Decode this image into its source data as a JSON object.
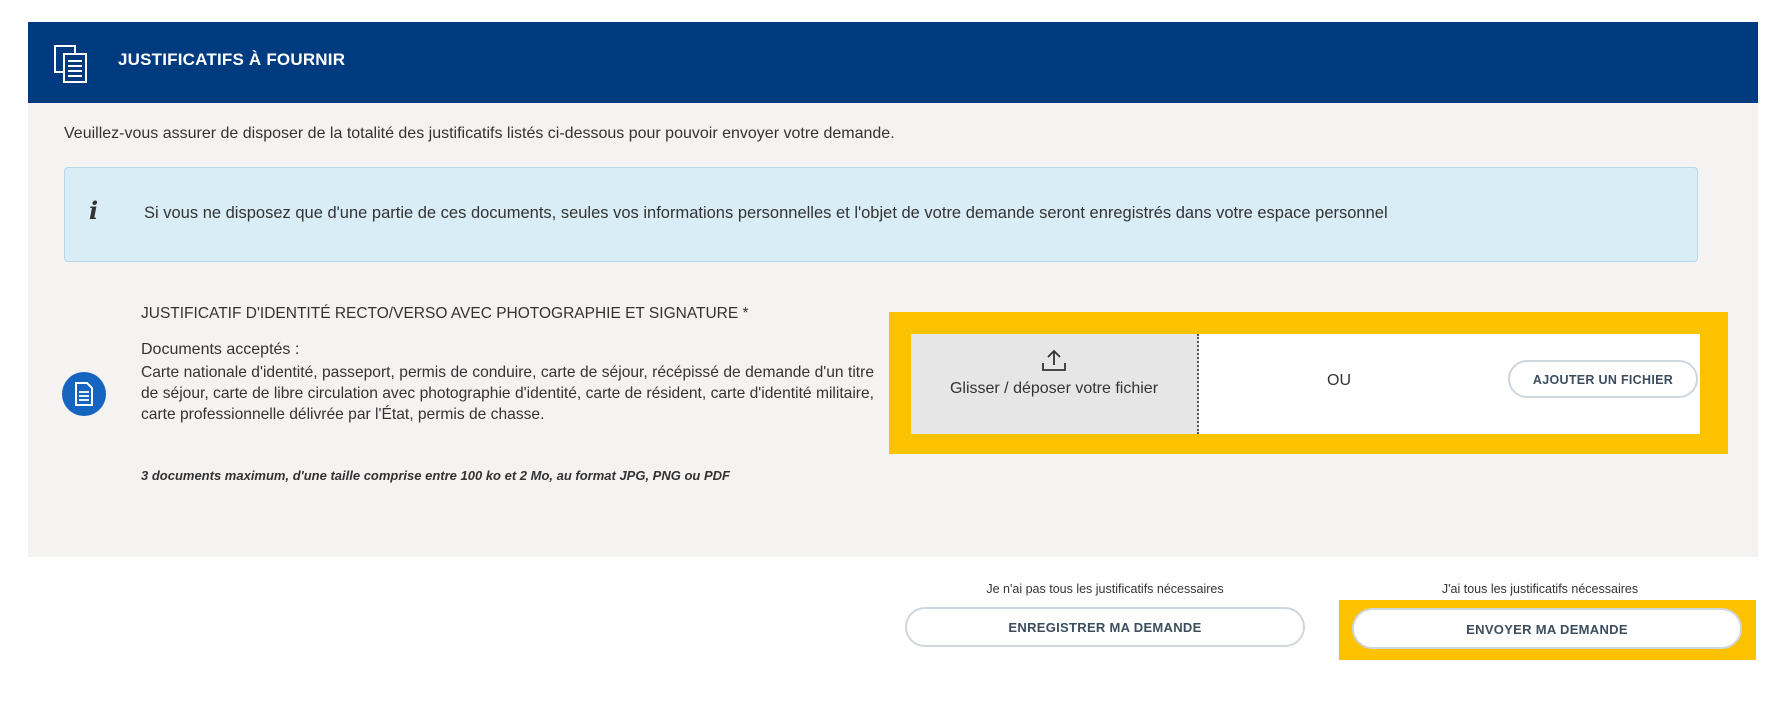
{
  "header": {
    "title": "JUSTIFICATIFS À FOURNIR",
    "icon": "documents-icon"
  },
  "intro": "Veuillez-vous assurer de disposer de la totalité des justificatifs listés ci-dessous pour pouvoir envoyer votre demande.",
  "info": {
    "icon_glyph": "i",
    "text": "Si vous ne disposez que d'une partie de ces documents, seules vos informations personnelles et l'objet de votre demande seront enregistrés dans votre espace personnel"
  },
  "document": {
    "title": "JUSTIFICATIF D'IDENTITÉ RECTO/VERSO AVEC PHOTOGRAPHIE ET SIGNATURE *",
    "accepted_label": "Documents acceptés :",
    "accepted_list": "Carte nationale d'identité, passeport, permis de conduire, carte de séjour, récépissé de demande d'un titre de séjour, carte de libre circulation avec photographie d'identité, carte de résident, carte d'identité militaire, carte professionnelle délivrée par l'État, permis de chasse.",
    "constraints": "3 documents maximum, d'une taille comprise entre 100 ko et 2 Mo, au format JPG, PNG ou PDF"
  },
  "upload": {
    "dropzone_label": "Glisser / déposer votre fichier",
    "or_label": "OU",
    "add_file_label": "AJOUTER UN FICHIER"
  },
  "actions": {
    "save_hint": "Je n'ai pas tous les justificatifs nécessaires",
    "save_label": "ENREGISTRER MA DEMANDE",
    "send_hint": "J'ai tous les justificatifs nécessaires",
    "send_label": "ENVOYER MA DEMANDE"
  },
  "colors": {
    "header_bg": "#003b80",
    "panel_bg": "#f5f3f2",
    "info_bg": "#d9edf7",
    "highlight": "#fcc200",
    "doc_icon": "#1565c0"
  }
}
